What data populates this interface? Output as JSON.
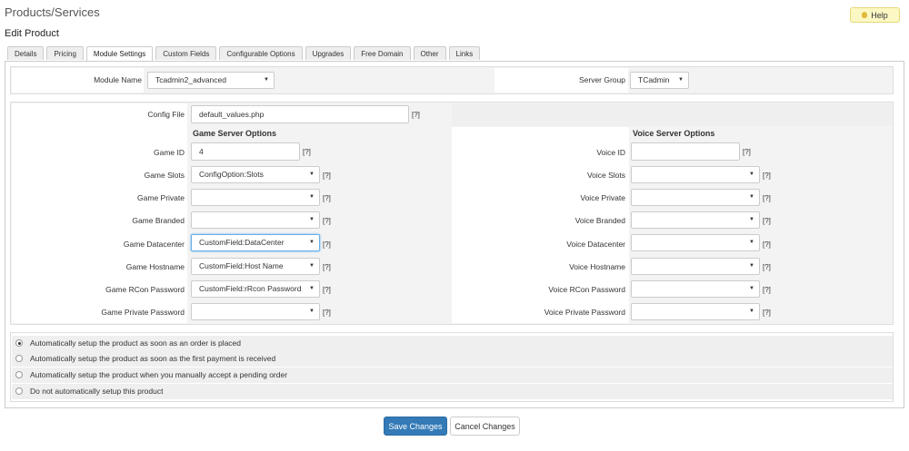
{
  "page": {
    "title": "Products/Services",
    "subtitle": "Edit Product",
    "help_label": "Help"
  },
  "tabs": [
    "Details",
    "Pricing",
    "Module Settings",
    "Custom Fields",
    "Configurable Options",
    "Upgrades",
    "Free Domain",
    "Other",
    "Links"
  ],
  "module": {
    "module_name_label": "Module Name",
    "module_name_value": "Tcadmin2_advanced",
    "server_group_label": "Server Group",
    "server_group_value": "TCadmin"
  },
  "config": {
    "config_file_label": "Config File",
    "config_file_value": "default_values.php",
    "help_marker": "[?]",
    "game_header": "Game Server Options",
    "voice_header": "Voice Server Options",
    "game_rows": [
      {
        "label": "Game ID",
        "value": "4"
      },
      {
        "label": "Game Slots",
        "value": "ConfigOption:Slots"
      },
      {
        "label": "Game Private",
        "value": ""
      },
      {
        "label": "Game Branded",
        "value": ""
      },
      {
        "label": "Game Datacenter",
        "value": "CustomField:DataCenter"
      },
      {
        "label": "Game Hostname",
        "value": "CustomField:Host Name"
      },
      {
        "label": "Game RCon Password",
        "value": "CustomField:rRcon Password"
      },
      {
        "label": "Game Private Password",
        "value": ""
      }
    ],
    "voice_rows": [
      {
        "label": "Voice ID",
        "value": ""
      },
      {
        "label": "Voice Slots",
        "value": ""
      },
      {
        "label": "Voice Private",
        "value": ""
      },
      {
        "label": "Voice Branded",
        "value": ""
      },
      {
        "label": "Voice Datacenter",
        "value": ""
      },
      {
        "label": "Voice Hostname",
        "value": ""
      },
      {
        "label": "Voice RCon Password",
        "value": ""
      },
      {
        "label": "Voice Private Password",
        "value": ""
      }
    ]
  },
  "setup_options": [
    "Automatically setup the product as soon as an order is placed",
    "Automatically setup the product as soon as the first payment is received",
    "Automatically setup the product when you manually accept a pending order",
    "Do not automatically setup this product"
  ],
  "buttons": {
    "save": "Save Changes",
    "cancel": "Cancel Changes"
  }
}
